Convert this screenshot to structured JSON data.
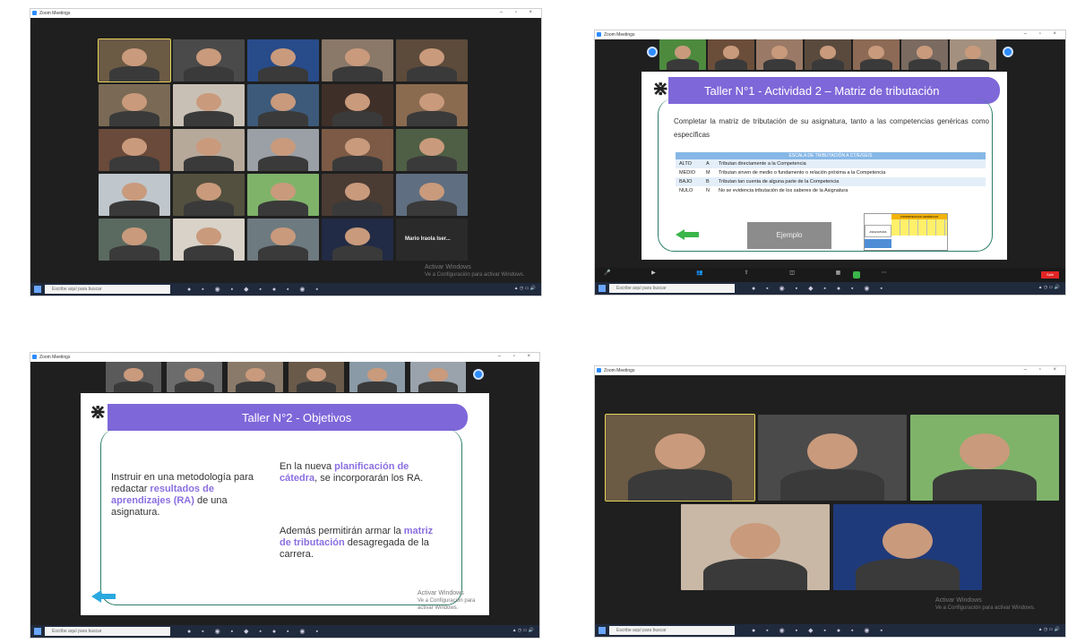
{
  "window_title": "Zoom Meetings",
  "taskbar_search": "Escribe aquí para buscar",
  "activate_windows": {
    "line1": "Activar Windows",
    "line2": "Ve a Configuración para activar Windows."
  },
  "speaker_label": "Mario Iraola Iser...",
  "slide1": {
    "title": "Taller N°1 - Actividad 2 – Matriz de tributación",
    "intro": "Completar la matriz de tributación de su asignatura, tanto a las competencias genéricas como específicas",
    "scale_header": "ESCALA DE TRIBUTACIÓN A CT/E/GE/S",
    "rows": [
      {
        "level": "ALTO",
        "code": "A",
        "text": "Tributan directamente a la Competencia"
      },
      {
        "level": "MEDIO",
        "code": "M",
        "text": "Tributan sirven de medio o fundamento o relación próxima a la Competencia"
      },
      {
        "level": "BAJO",
        "code": "B",
        "text": "Tributan tan cuenta de alguna parte de la Competencia"
      },
      {
        "level": "NULO",
        "code": "N",
        "text": "No se evidencia tributación de los saberes de la Asignatura"
      }
    ],
    "button": "Ejemplo",
    "matrix_header": "COMPETENCIAS GENÉRICAS",
    "matrix_row_label": "ASIGNATURA"
  },
  "slide2": {
    "title": "Taller N°2 - Objetivos",
    "left_pre": "Instruir en una metodología para redactar",
    "left_hl": "resultados de aprendizajes (RA)",
    "left_post": "de una asignatura.",
    "right1_pre": "En la nueva",
    "right1_hl": "planificación de cátedra",
    "right1_post": ", se incorporarán los RA.",
    "right2_pre": "Además permitirán armar la",
    "right2_hl": "matriz de tributación",
    "right2_post": "desagregada de la carrera."
  },
  "colors": {
    "zoom_bg": "#1f1f1f",
    "banner": "#7e67d9",
    "highlight": "#8b6fe0",
    "frame": "#2d7d6a",
    "zoom_blue": "#2d8cff",
    "end_red": "#e02424"
  },
  "toolbar": {
    "end": "Salir"
  },
  "icons": [
    "zoom-logo-icon",
    "windows-start-icon",
    "search-icon",
    "zoom-participant-nav-icon",
    "arrow-left-icon"
  ]
}
